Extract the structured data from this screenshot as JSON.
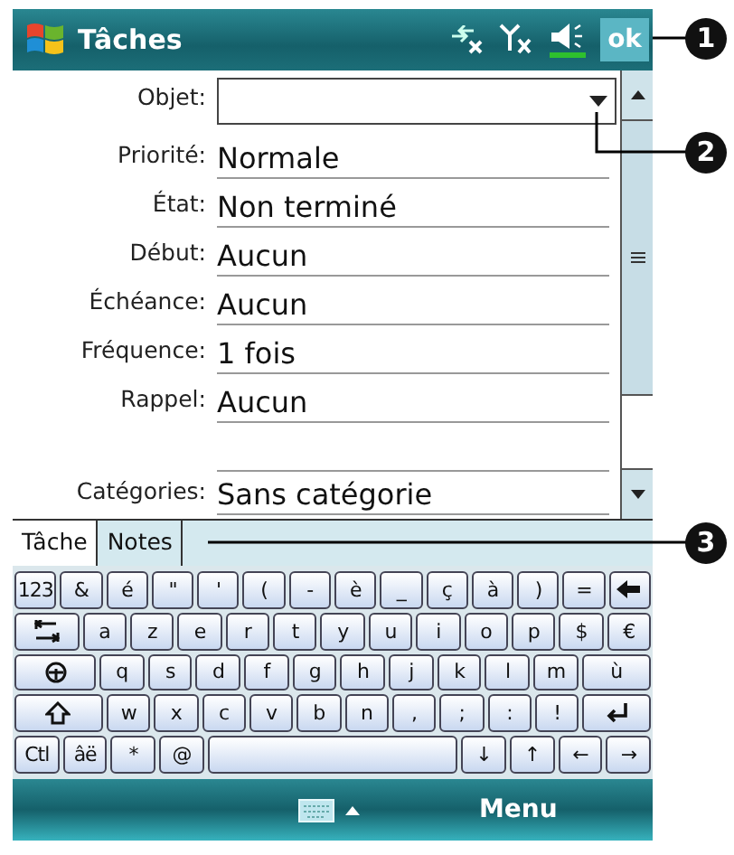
{
  "title_bar": {
    "title": "Tâches",
    "ok_button": "ok"
  },
  "form": [
    {
      "kind": "combo",
      "label": "Objet:"
    },
    {
      "kind": "text",
      "label": "Priorité:",
      "value": "Normale"
    },
    {
      "kind": "text",
      "label": "État:",
      "value": "Non terminé"
    },
    {
      "kind": "text",
      "label": "Début:",
      "value": "Aucun"
    },
    {
      "kind": "text",
      "label": "Échéance:",
      "value": "Aucun"
    },
    {
      "kind": "text",
      "label": "Fréquence:",
      "value": "1 fois"
    },
    {
      "kind": "text",
      "label": "Rappel:",
      "value": "Aucun"
    },
    {
      "kind": "blank"
    },
    {
      "kind": "text",
      "label": "Catégories:",
      "value": "Sans catégorie"
    }
  ],
  "tabs": [
    {
      "label": "Tâche",
      "selected": true
    },
    {
      "label": "Notes",
      "selected": false
    }
  ],
  "keyboard": [
    [
      {
        "label": "123"
      },
      {
        "label": "&"
      },
      {
        "label": "é"
      },
      {
        "label": "\""
      },
      {
        "label": "'"
      },
      {
        "label": "("
      },
      {
        "label": "-"
      },
      {
        "label": "è"
      },
      {
        "label": "_"
      },
      {
        "label": "ç"
      },
      {
        "label": "à"
      },
      {
        "label": ")"
      },
      {
        "label": "="
      },
      {
        "kind": "backspace"
      }
    ],
    [
      {
        "kind": "tab"
      },
      {
        "label": "a"
      },
      {
        "label": "z"
      },
      {
        "label": "e"
      },
      {
        "label": "r"
      },
      {
        "label": "t"
      },
      {
        "label": "y"
      },
      {
        "label": "u"
      },
      {
        "label": "i"
      },
      {
        "label": "o"
      },
      {
        "label": "p"
      },
      {
        "label": "$"
      },
      {
        "label": "€"
      }
    ],
    [
      {
        "kind": "caps"
      },
      {
        "label": "q"
      },
      {
        "label": "s"
      },
      {
        "label": "d"
      },
      {
        "label": "f"
      },
      {
        "label": "g"
      },
      {
        "label": "h"
      },
      {
        "label": "j"
      },
      {
        "label": "k"
      },
      {
        "label": "l"
      },
      {
        "label": "m"
      },
      {
        "label": "ù",
        "kind": "wide"
      }
    ],
    [
      {
        "kind": "shift"
      },
      {
        "label": "w"
      },
      {
        "label": "x"
      },
      {
        "label": "c"
      },
      {
        "label": "v"
      },
      {
        "label": "b"
      },
      {
        "label": "n"
      },
      {
        "label": ","
      },
      {
        "label": ";"
      },
      {
        "label": ":"
      },
      {
        "label": "!"
      },
      {
        "kind": "enter"
      }
    ],
    [
      {
        "label": "Ctl"
      },
      {
        "label": "âë"
      },
      {
        "label": "*"
      },
      {
        "label": "@"
      },
      {
        "kind": "space"
      },
      {
        "label": "↓"
      },
      {
        "label": "↑"
      },
      {
        "label": "←"
      },
      {
        "label": "→"
      }
    ]
  ],
  "menu_bar": {
    "menu": "Menu"
  },
  "callouts": [
    "1",
    "2",
    "3"
  ]
}
